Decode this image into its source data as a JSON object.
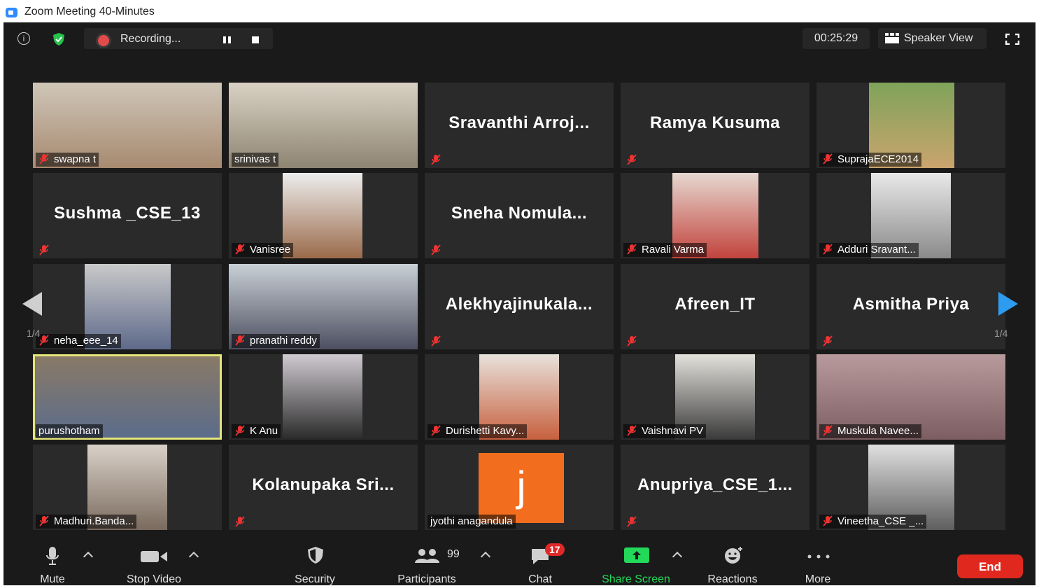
{
  "window": {
    "title": "Zoom Meeting 40-Minutes"
  },
  "topbar": {
    "recording_label": "Recording...",
    "timer": "00:25:29",
    "view_label": "Speaker View"
  },
  "pagination": {
    "left": "1/4",
    "right": "1/4"
  },
  "tiles": [
    {
      "name": "swapna t",
      "display": "video"
    },
    {
      "name": "srinivas t",
      "display": "video"
    },
    {
      "big": "Sravanthi  Arroj..."
    },
    {
      "big": "Ramya Kusuma"
    },
    {
      "name": "SuprajaECE2014",
      "display": "video"
    },
    {
      "big": "Sushma _CSE_13"
    },
    {
      "name": "Vanisree",
      "display": "video"
    },
    {
      "big": "Sneha  Nomula..."
    },
    {
      "name": "Ravali Varma",
      "display": "video"
    },
    {
      "name": "Adduri Sravant...",
      "display": "video"
    },
    {
      "name": "neha_eee_14",
      "display": "video"
    },
    {
      "name": "pranathi reddy",
      "display": "video"
    },
    {
      "big": "Alekhyajinukala..."
    },
    {
      "big": "Afreen_IT"
    },
    {
      "big": "Asmitha  Priya"
    },
    {
      "name": "purushotham",
      "display": "video"
    },
    {
      "name": "K Anu",
      "display": "video"
    },
    {
      "name": "Durishetti Kavy...",
      "display": "video"
    },
    {
      "name": "Vaishnavi PV",
      "display": "video"
    },
    {
      "name": "Muskula Navee...",
      "display": "video"
    },
    {
      "name": "Madhuri.Banda...",
      "display": "video"
    },
    {
      "big": "Kolanupaka  Sri..."
    },
    {
      "name": "jyothi anagandula",
      "avatar_letter": "j"
    },
    {
      "big": "Anupriya_CSE_1..."
    },
    {
      "name": "Vineetha_CSE _...",
      "display": "video"
    }
  ],
  "toolbar": {
    "mute": "Mute",
    "stop_video": "Stop Video",
    "security": "Security",
    "participants": "Participants",
    "participants_count": "99",
    "chat": "Chat",
    "chat_badge": "17",
    "share_screen": "Share Screen",
    "reactions": "Reactions",
    "more": "More",
    "end": "End"
  },
  "colors": {
    "share_green": "#23d959",
    "end_red": "#e0281e",
    "active_speaker": "#e6e57a",
    "next_arrow": "#2d9bf0"
  }
}
